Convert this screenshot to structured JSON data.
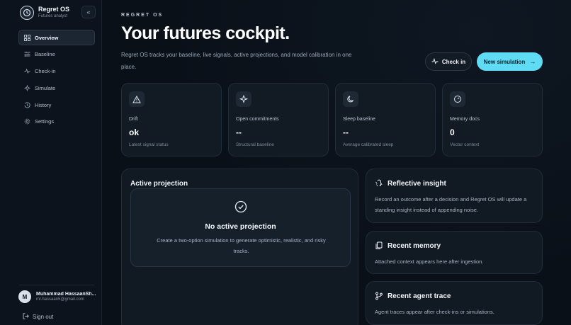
{
  "sidebar": {
    "brand_name": "Regret OS",
    "brand_sub": "Futures analyst",
    "items": [
      {
        "label": "Overview",
        "icon": "grid-icon",
        "active": true
      },
      {
        "label": "Baseline",
        "icon": "sliders-icon"
      },
      {
        "label": "Check-in",
        "icon": "pulse-icon"
      },
      {
        "label": "Simulate",
        "icon": "sparkle-icon"
      },
      {
        "label": "History",
        "icon": "history-icon"
      },
      {
        "label": "Settings",
        "icon": "gear-icon"
      }
    ],
    "user": {
      "initial": "M",
      "name": "Muhammad HassaanSh...",
      "email": "mr.hassaan5@gmail.com"
    },
    "sign_out": "Sign out"
  },
  "header": {
    "eyebrow": "REGRET OS",
    "title": "Your futures cockpit.",
    "subtitle": "Regret OS tracks your baseline, live signals, active projections, and model calibration in one place.",
    "check_in_label": "Check in",
    "new_sim_label": "New simulation"
  },
  "stats": [
    {
      "label": "Drift",
      "value": "ok",
      "caption": "Latest signal status",
      "icon": "warning-icon"
    },
    {
      "label": "Open commitments",
      "value": "--",
      "caption": "Structural baseline",
      "icon": "sparkle-icon"
    },
    {
      "label": "Sleep baseline",
      "value": "--",
      "caption": "Average calibrated sleep",
      "icon": "moon-icon"
    },
    {
      "label": "Memory docs",
      "value": "0",
      "caption": "Vector context",
      "icon": "gauge-icon"
    }
  ],
  "projection": {
    "title": "Active projection",
    "empty_title": "No active projection",
    "empty_desc": "Create a two-option simulation to generate optimistic, realistic, and risky tracks."
  },
  "cards": {
    "insight": {
      "title": "Reflective insight",
      "body": "Record an outcome after a decision and Regret OS will update a standing insight instead of appending noise."
    },
    "memory": {
      "title": "Recent memory",
      "body": "Attached context appears here after ingestion."
    },
    "trace": {
      "title": "Recent agent trace",
      "body": "Agent traces appear after check-ins or simulations."
    }
  },
  "colors": {
    "accent": "#5fdcf3",
    "background": "#0a1018",
    "card": "#121a24"
  }
}
